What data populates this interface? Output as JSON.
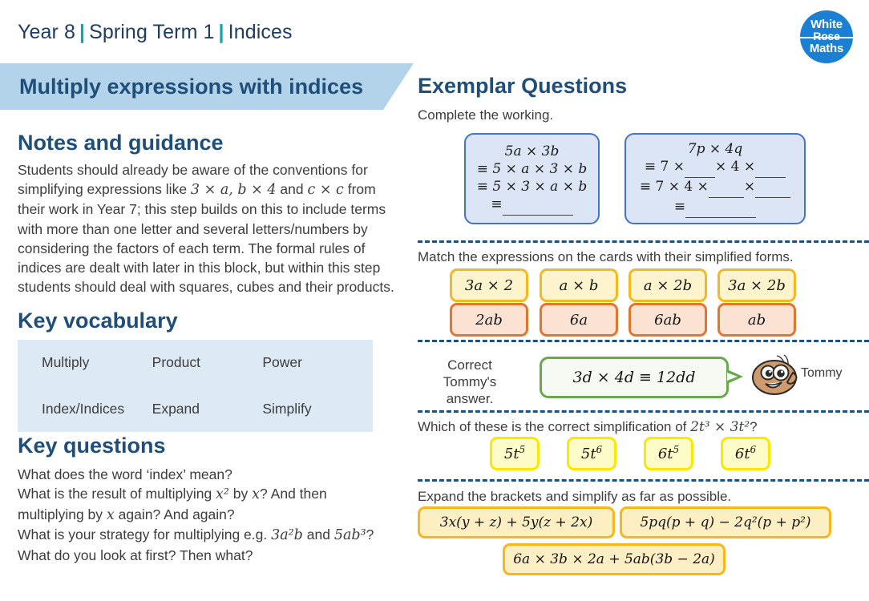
{
  "header": {
    "year": "Year 8",
    "term": "Spring Term 1",
    "topic": "Indices",
    "separator": "|"
  },
  "logo": {
    "line1": "White",
    "line2": "Rose",
    "line3": "Maths"
  },
  "banner": {
    "title": "Multiply expressions with indices",
    "bg_color": "#b2d3ea",
    "text_color": "#1f4e79"
  },
  "left": {
    "notes": {
      "heading": "Notes and guidance",
      "paragraph_parts": {
        "t1": "Students should already be aware of the conventions for simplifying expressions like ",
        "m1": "3 × a, b × 4",
        "t2": " and ",
        "m2": "c × c",
        "t3": " from their work in Year 7; this step builds on this to include terms with more than one letter and several letters/numbers by considering the factors of each term. The formal rules of indices are dealt with later in this block, but within this step students should deal with squares, cubes and their products."
      }
    },
    "vocabulary": {
      "heading": "Key vocabulary",
      "terms": [
        "Multiply",
        "Product",
        "Power",
        "Index/Indices",
        "Expand",
        "Simplify"
      ],
      "bg_color": "#dde9f5"
    },
    "questions": {
      "heading": "Key questions",
      "lines": [
        {
          "t1": "What does the word ‘index’ mean?",
          "m1": "",
          "t2": "",
          "m2": "",
          "t3": ""
        },
        {
          "t1": "What is the result of multiplying ",
          "m1": "x²",
          "t2": " by ",
          "m2": "x",
          "t3": "? And then"
        },
        {
          "t1": "multiplying by ",
          "m1": "x",
          "t2": " again? And again?",
          "m2": "",
          "t3": ""
        },
        {
          "t1": "What is your strategy for multiplying e.g. ",
          "m1": "3a²b",
          "t2": " and ",
          "m2": "5ab³",
          "t3": "?"
        },
        {
          "t1": "What do you look at first? Then what?",
          "m1": "",
          "t2": "",
          "m2": "",
          "t3": ""
        }
      ]
    }
  },
  "right": {
    "heading": "Exemplar Questions",
    "prompt_complete": "Complete the working.",
    "prompt_match": "Match the expressions on the cards with their simplified forms.",
    "prompt_correct": "Correct Tommy's answer.",
    "prompt_which": {
      "t1": "Which of these is the correct simplification of ",
      "m1": "2t³ × 3t²",
      "t2": "?"
    },
    "prompt_expand": "Expand the brackets and simplify as far as possible.",
    "working_boxes": [
      {
        "lines": [
          "5a × 3b",
          "≡ 5 × a × 3 × b",
          "≡ 5 × 3 × a × b",
          "≡"
        ],
        "blank_widths": [
          0,
          0,
          0,
          92
        ]
      },
      {
        "lines": [
          "7p × 4q",
          "≡ 7 ×",
          "≡ 7 × 4 ×",
          "≡"
        ],
        "blank_widths": [
          0,
          0,
          0,
          92
        ]
      }
    ],
    "box2_row2": {
      "a": "≡ 7 ×",
      "b": "× 4 ×"
    },
    "box2_row3": {
      "a": "≡ 7 × 4 ×",
      "b": "×"
    },
    "match_cards_yellow": [
      "3a × 2",
      "a × b",
      "a × 2b",
      "3a × 2b"
    ],
    "match_cards_orange": [
      "2ab",
      "6a",
      "6ab",
      "ab"
    ],
    "tommy": {
      "statement": "3d × 4d ≡ 12dd",
      "name": "Tommy",
      "bubble_border": "#6aa84f"
    },
    "mcq_options": [
      {
        "base": "5t",
        "exp": "5"
      },
      {
        "base": "5t",
        "exp": "6"
      },
      {
        "base": "6t",
        "exp": "5"
      },
      {
        "base": "6t",
        "exp": "6"
      }
    ],
    "expand_cards": [
      "3x(y + z) + 5y(z + 2x)",
      "5pq(p + q) − 2q²(p + p²)",
      "6a × 3b × 2a + 5ab(3b − 2a)"
    ]
  }
}
